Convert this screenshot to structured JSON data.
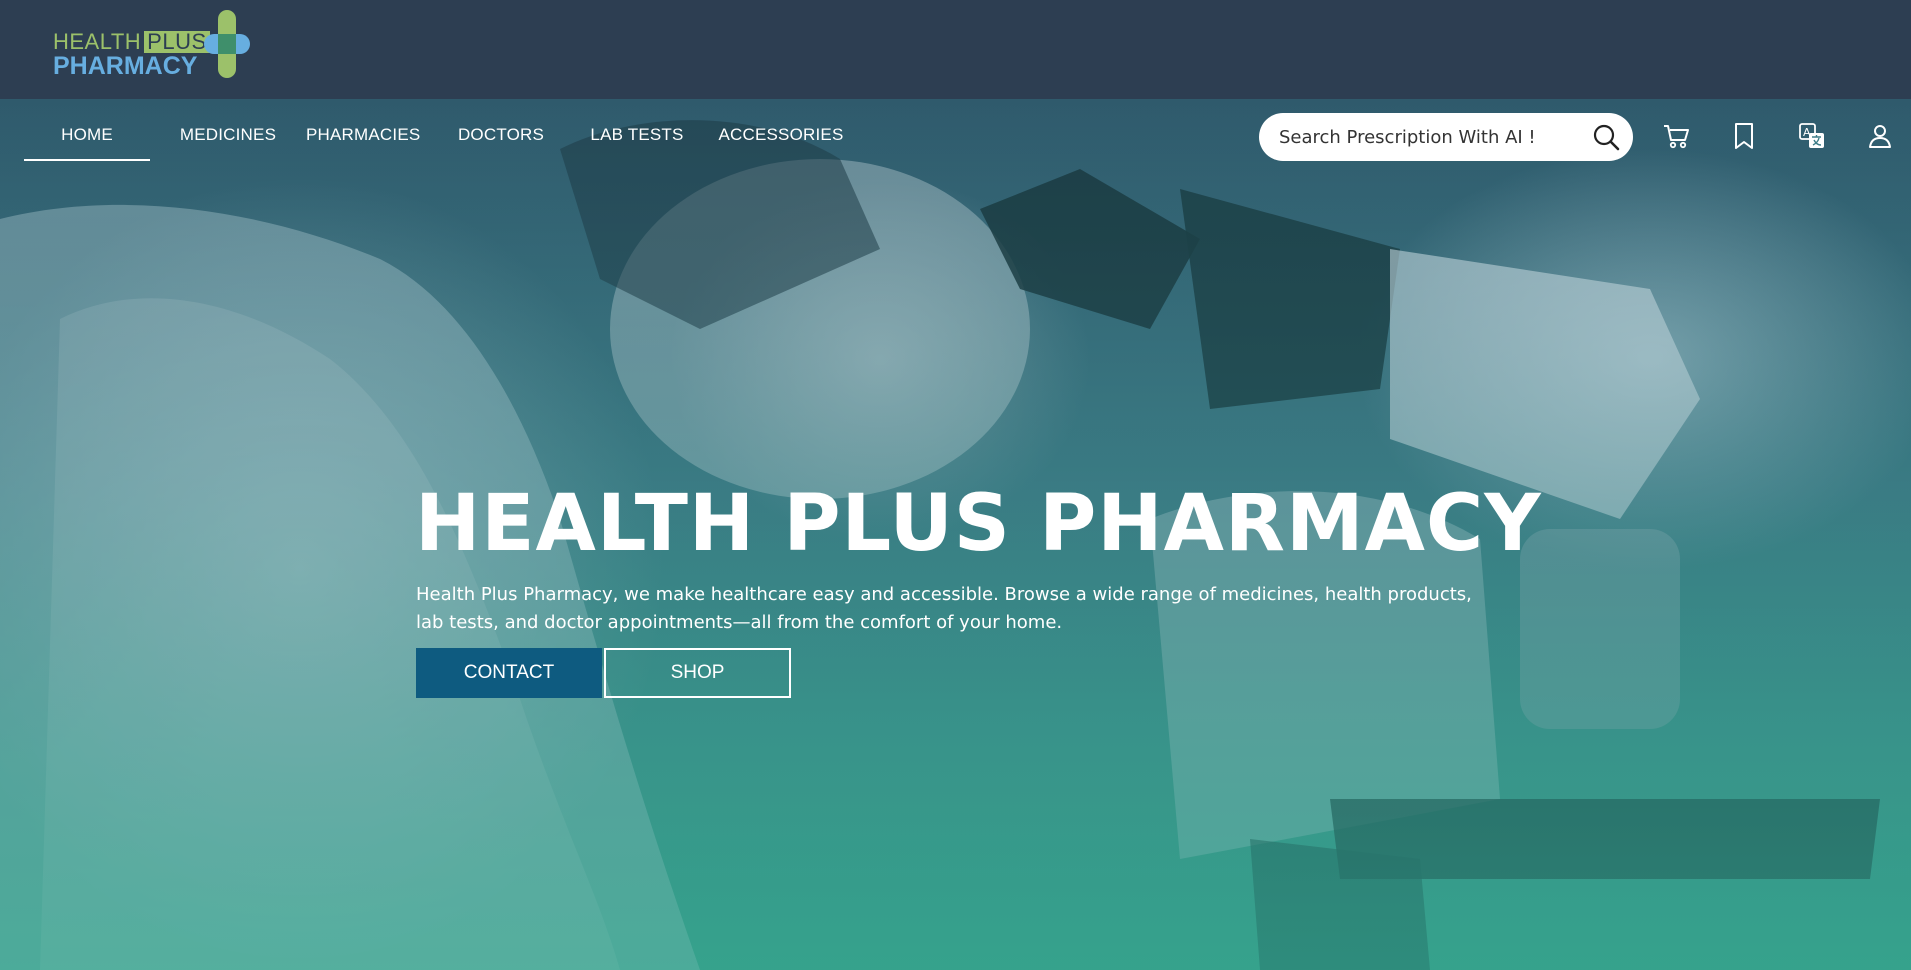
{
  "brand": {
    "logo_line1": "HEALTH",
    "logo_line1_highlight": "PLUS",
    "logo_line2": "PHARMACY",
    "colors": {
      "green": "#9cc16a",
      "blue": "#67aee0",
      "header_bg": "#2d3e52"
    }
  },
  "nav": {
    "items": [
      {
        "label": "HOME",
        "active": true
      },
      {
        "label": "MEDICINES",
        "active": false
      },
      {
        "label": "PHARMACIES",
        "active": false
      },
      {
        "label": "DOCTORS",
        "active": false
      },
      {
        "label": "LAB TESTS",
        "active": false
      },
      {
        "label": "ACCESSORIES",
        "active": false
      }
    ]
  },
  "search": {
    "placeholder": "Search Prescription With AI !",
    "icon": "search-icon"
  },
  "header_icons": [
    "cart-icon",
    "bookmark-icon",
    "translate-icon",
    "user-icon"
  ],
  "hero": {
    "title": "HEALTH PLUS PHARMACY",
    "description": "Health Plus Pharmacy, we make healthcare easy and accessible. Browse a wide range of medicines, health products, lab tests, and doctor appointments—all from the comfort of your home.",
    "buttons": {
      "contact": "CONTACT",
      "shop": "SHOP"
    },
    "accent": "#0e5b80"
  }
}
